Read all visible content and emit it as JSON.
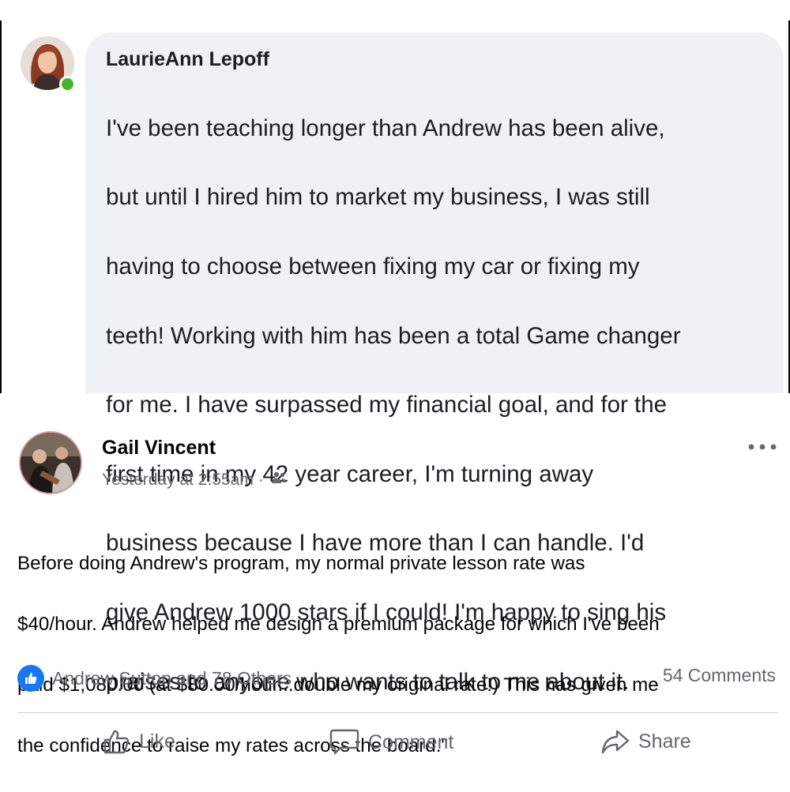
{
  "comment": {
    "author": "LaurieAnn Lepoff",
    "lines": [
      "I've been teaching longer than Andrew has been alive,",
      "but until I hired him to market my business, I was still",
      "having to choose between fixing my car or fixing my",
      "teeth! Working with him has been a total Game changer",
      "for me. I have surpassed my financial goal, and for the",
      "first time in my 42 year career, I'm turning away",
      "business because I have more than I can handle. I'd",
      "give Andrew 1000 stars if I could! I'm happy to sing his",
      "praises to anyone who wants to talk to me about it."
    ],
    "online_status_color": "#42b72a",
    "bubble_color": "#eff2f5"
  },
  "post": {
    "author": "Gail Vincent",
    "timestamp": "Yesterday at 2:55am",
    "meta_separator": "·",
    "audience_icon": "friends-icon",
    "more_icon": "more-options-icon",
    "lines": [
      "Before doing Andrew's program, my normal private lesson rate was",
      "$40/hour. Andrew helped me design a premium package for which I've been",
      "paid $1,080.00 (at $80.00/hour...double my original rate!) This has given me",
      "the confidence to raise my rates across the board.\""
    ],
    "reactions": {
      "icon": "like-reaction-icon",
      "text": "Andrew Sutton and 78 Others",
      "color": "#1877f2"
    },
    "comments_count": "54 Comments",
    "actions": {
      "like": {
        "label": "Like",
        "icon": "thumbs-up-icon"
      },
      "comment": {
        "label": "Comment",
        "icon": "comment-bubble-icon"
      },
      "share": {
        "label": "Share",
        "icon": "share-arrow-icon"
      }
    }
  }
}
